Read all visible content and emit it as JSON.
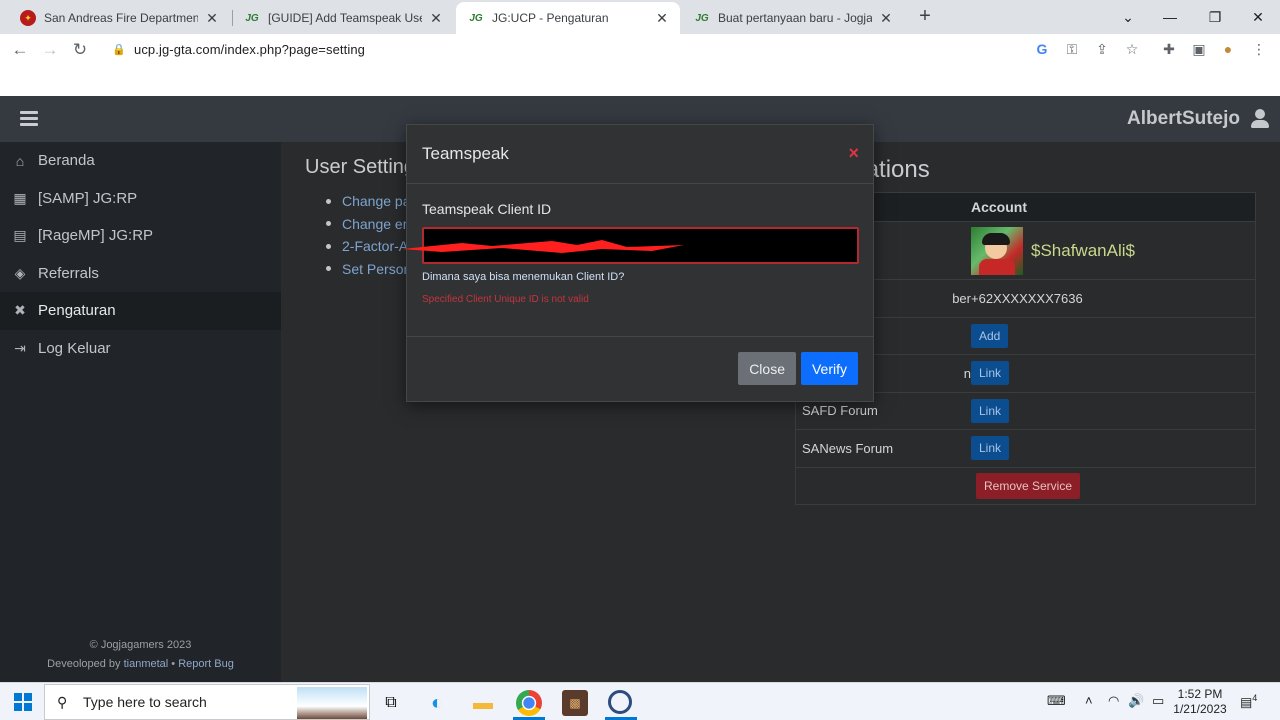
{
  "browser": {
    "tabs": [
      {
        "title": "San Andreas Fire Department - P",
        "favicon": "fire-dept-icon",
        "active": false
      },
      {
        "title": "[GUIDE] Add Teamspeak User to",
        "favicon": "jg-logo-icon",
        "active": false
      },
      {
        "title": "JG:UCP - Pengaturan",
        "favicon": "jg-logo-icon",
        "active": true
      },
      {
        "title": "Buat pertanyaan baru - Jogjagam",
        "favicon": "jg-logo-icon",
        "active": false
      }
    ],
    "favicon_text": "JG",
    "url": "ucp.jg-gta.com/index.php?page=setting"
  },
  "topnav": {
    "username": "AlbertSutejo"
  },
  "sidebar": {
    "items": [
      {
        "label": "Beranda",
        "icon": "home-icon",
        "active": false
      },
      {
        "label": "[SAMP] JG:RP",
        "icon": "samp-icon",
        "active": false
      },
      {
        "label": "[RageMP] JG:RP",
        "icon": "ragemp-icon",
        "active": false
      },
      {
        "label": "Referrals",
        "icon": "referrals-icon",
        "active": false
      },
      {
        "label": "Pengaturan",
        "icon": "wrench-icon",
        "active": true
      },
      {
        "label": "Log Keluar",
        "icon": "logout-icon",
        "active": false
      }
    ],
    "footer": {
      "copyright": "© Jogjagamers 2023",
      "developed_prefix": "Deveoloped by ",
      "developer": "tianmetal",
      "separator": " • ",
      "report": "Report Bug"
    }
  },
  "user_settings": {
    "title": "User Settings",
    "items": [
      "Change pa",
      "Change em",
      "2-Factor-A",
      "Set Person"
    ]
  },
  "associations": {
    "title": "Associations",
    "header": {
      "col1": "",
      "col2": "Account"
    },
    "account_name": "$ShafwanAli$",
    "phone_label": "ber",
    "phone_value": "+62XXXXXXX7636",
    "add_label": "Add",
    "link_row_suffix": "n",
    "link_label": "Link",
    "safd_label": "SAFD Forum",
    "sanews_label": "SANews Forum",
    "remove_label": "Remove Service"
  },
  "modal": {
    "title": "Teamspeak",
    "close_icon": "×",
    "field_label": "Teamspeak Client ID",
    "input_value": "",
    "help_link": "Dimana saya bisa menemukan Client ID?",
    "error": "Specified Client Unique ID is not valid",
    "close_button": "Close",
    "verify_button": "Verify"
  },
  "taskbar": {
    "search_placeholder": "Type here to search",
    "time": "1:52 PM",
    "date": "1/21/2023",
    "notification_count": "4"
  },
  "colors": {
    "accent": "#0d6efd",
    "danger": "#dc3545",
    "page_bg": "#292b2d",
    "sidebar_bg": "#212529"
  }
}
